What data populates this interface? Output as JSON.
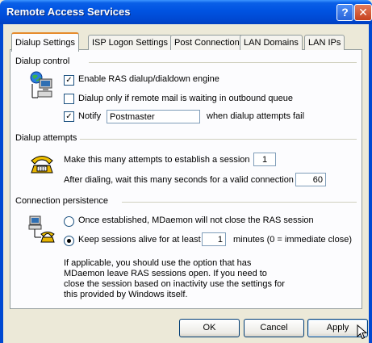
{
  "window": {
    "title": "Remote Access Services",
    "help_glyph": "?",
    "close_glyph": "✕"
  },
  "tabs": [
    {
      "label": "Dialup Settings",
      "active": true
    },
    {
      "label": "ISP Logon Settings",
      "active": false
    },
    {
      "label": "Post Connection",
      "active": false
    },
    {
      "label": "LAN Domains",
      "active": false
    },
    {
      "label": "LAN IPs",
      "active": false
    }
  ],
  "dialup_control": {
    "title": "Dialup control",
    "enable_ras": {
      "label": "Enable RAS dialup/dialdown engine",
      "checked": true
    },
    "only_if_mail": {
      "label": "Dialup only if remote mail is waiting in outbound queue",
      "checked": false
    },
    "notify": {
      "label": "Notify",
      "checked": true,
      "value": "Postmaster",
      "suffix": "when dialup attempts fail"
    }
  },
  "dialup_attempts": {
    "title": "Dialup attempts",
    "attempts_label": "Make this many attempts to establish a session",
    "attempts_value": "1",
    "wait_label": "After dialing, wait this many seconds for a valid connection",
    "wait_value": "60"
  },
  "persistence": {
    "title": "Connection persistence",
    "option_close": "Once established, MDaemon will not close the RAS session",
    "option_keep_prefix": "Keep sessions alive for at least",
    "option_keep_value": "1",
    "option_keep_suffix": "minutes (0 = immediate close)",
    "selected": "keep",
    "note": "If applicable, you should use the option that has MDaemon leave RAS sessions open.  If you need to close the session based on inactivity use the settings for this provided by Windows itself."
  },
  "buttons": {
    "ok": "OK",
    "cancel": "Cancel",
    "apply": "Apply"
  },
  "colors": {
    "titlebar": "#0053e1",
    "tab_highlight": "#e68b2c"
  },
  "icons": [
    "help-icon",
    "close-icon",
    "network-globe-icon",
    "telephone-icon",
    "network-computers-icon",
    "mouse-cursor-icon"
  ]
}
